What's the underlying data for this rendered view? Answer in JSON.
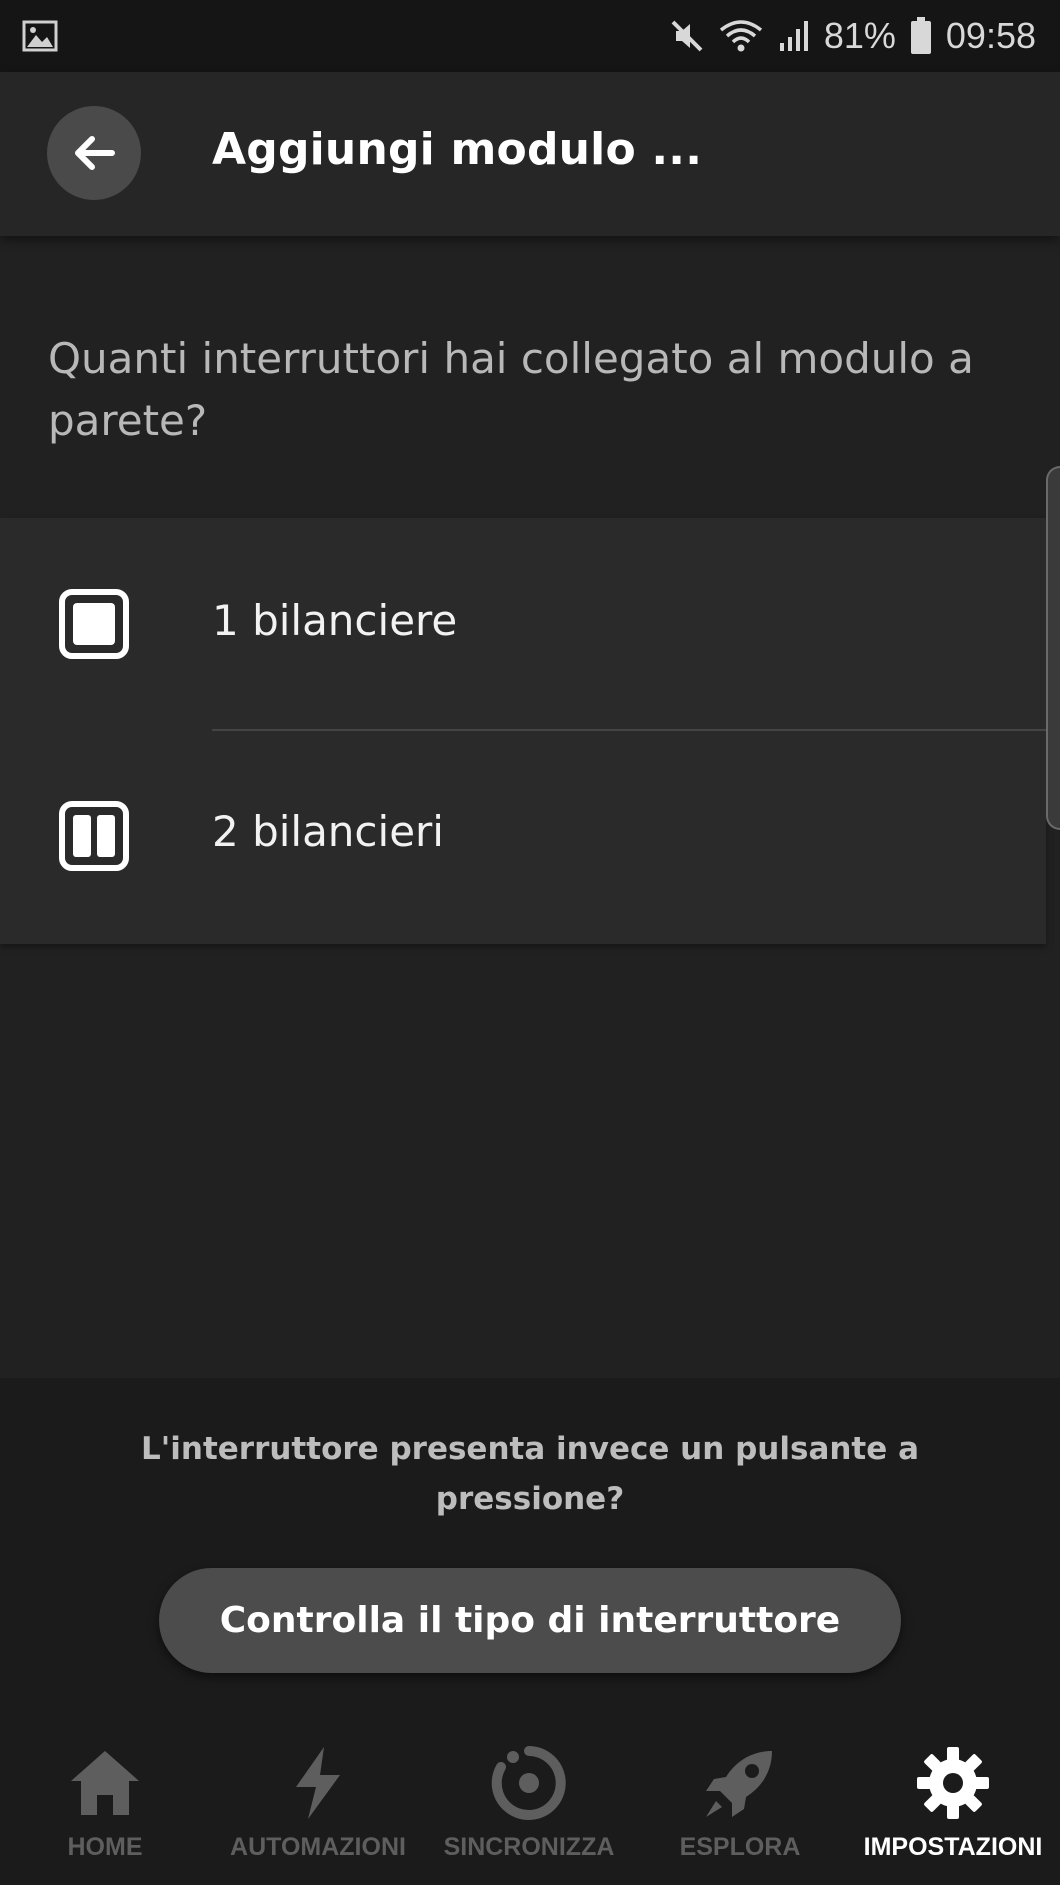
{
  "status_bar": {
    "battery_percent": "81%",
    "time": "09:58",
    "icons": [
      "gallery-icon",
      "mute-icon",
      "wifi-icon",
      "signal-icon",
      "battery-icon"
    ]
  },
  "app_bar": {
    "title": "Aggiungi modulo ..."
  },
  "question": "Quanti interruttori hai collegato al modulo a parete?",
  "options": [
    {
      "label": "1 bilanciere",
      "icon": "single-rocker-icon"
    },
    {
      "label": "2 bilancieri",
      "icon": "double-rocker-icon"
    }
  ],
  "hint": "L'interruttore presenta invece un pulsante a pressione?",
  "check_button": "Controlla il tipo di interruttore",
  "bottom_nav": {
    "items": [
      {
        "label": "HOME",
        "icon": "home-icon",
        "active": false
      },
      {
        "label": "AUTOMAZIONI",
        "icon": "lightning-icon",
        "active": false
      },
      {
        "label": "SINCRONIZZA",
        "icon": "sync-icon",
        "active": false
      },
      {
        "label": "ESPLORA",
        "icon": "rocket-icon",
        "active": false
      },
      {
        "label": "IMPOSTAZIONI",
        "icon": "gear-icon",
        "active": true
      }
    ]
  },
  "colors": {
    "background": "#212121",
    "app_bar": "#262626",
    "list": "#2a2a2a",
    "button": "#4c4c4c",
    "nav_inactive": "#5e5e5e",
    "nav_active": "#ffffff"
  }
}
